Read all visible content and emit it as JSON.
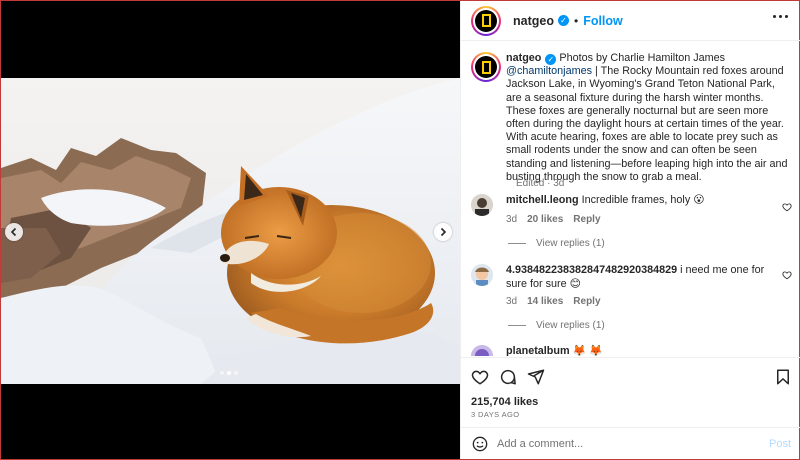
{
  "header": {
    "username": "natgeo",
    "separator": "•",
    "follow_label": "Follow"
  },
  "caption": {
    "username": "natgeo",
    "prefix": "Photos by Charlie Hamilton James",
    "mention": "@chamiltonjames",
    "pipe": "|",
    "body": "The Rocky Mountain red foxes around Jackson Lake, in Wyoming's Grand Teton National Park, are a seasonal fixture during the harsh winter months. These foxes are generally nocturnal but are seen more often during the daylight hours at certain times of the year. With acute hearing, foxes are able to locate prey such as small rodents under the snow and can often be seen standing and listening—before leaping high into the air and busting through the snow to grab a meal.",
    "edited": "Edited · 3d"
  },
  "comments": [
    {
      "username": "mitchell.leong",
      "text": "Incredible frames, holy 😮",
      "age": "3d",
      "likes": "20 likes",
      "reply_label": "Reply",
      "view_replies": "View replies (1)"
    },
    {
      "username": "4.938482238382847482920384829",
      "text": "i need me one for sure for sure 😊",
      "age": "3d",
      "likes": "14 likes",
      "reply_label": "Reply",
      "view_replies": "View replies (1)"
    },
    {
      "username": "planetalbum",
      "text": "🦊 🦊"
    }
  ],
  "stats": {
    "likes": "215,704 likes",
    "date": "3 DAYS AGO"
  },
  "comment_box": {
    "placeholder": "Add a comment...",
    "post_label": "Post"
  },
  "carousel": {
    "slide_count": 3,
    "active_index": 1
  },
  "icons": {
    "verified": "verified-badge-icon",
    "more": "more-options-icon",
    "like": "heart-icon",
    "comment": "comment-icon",
    "share": "share-icon",
    "save": "bookmark-icon",
    "emoji": "emoji-icon",
    "prev": "chevron-left-icon",
    "next": "chevron-right-icon"
  },
  "colors": {
    "accent": "#0095f6",
    "border": "#efefef",
    "muted": "#737373",
    "post_disabled": "#b3dbff"
  }
}
